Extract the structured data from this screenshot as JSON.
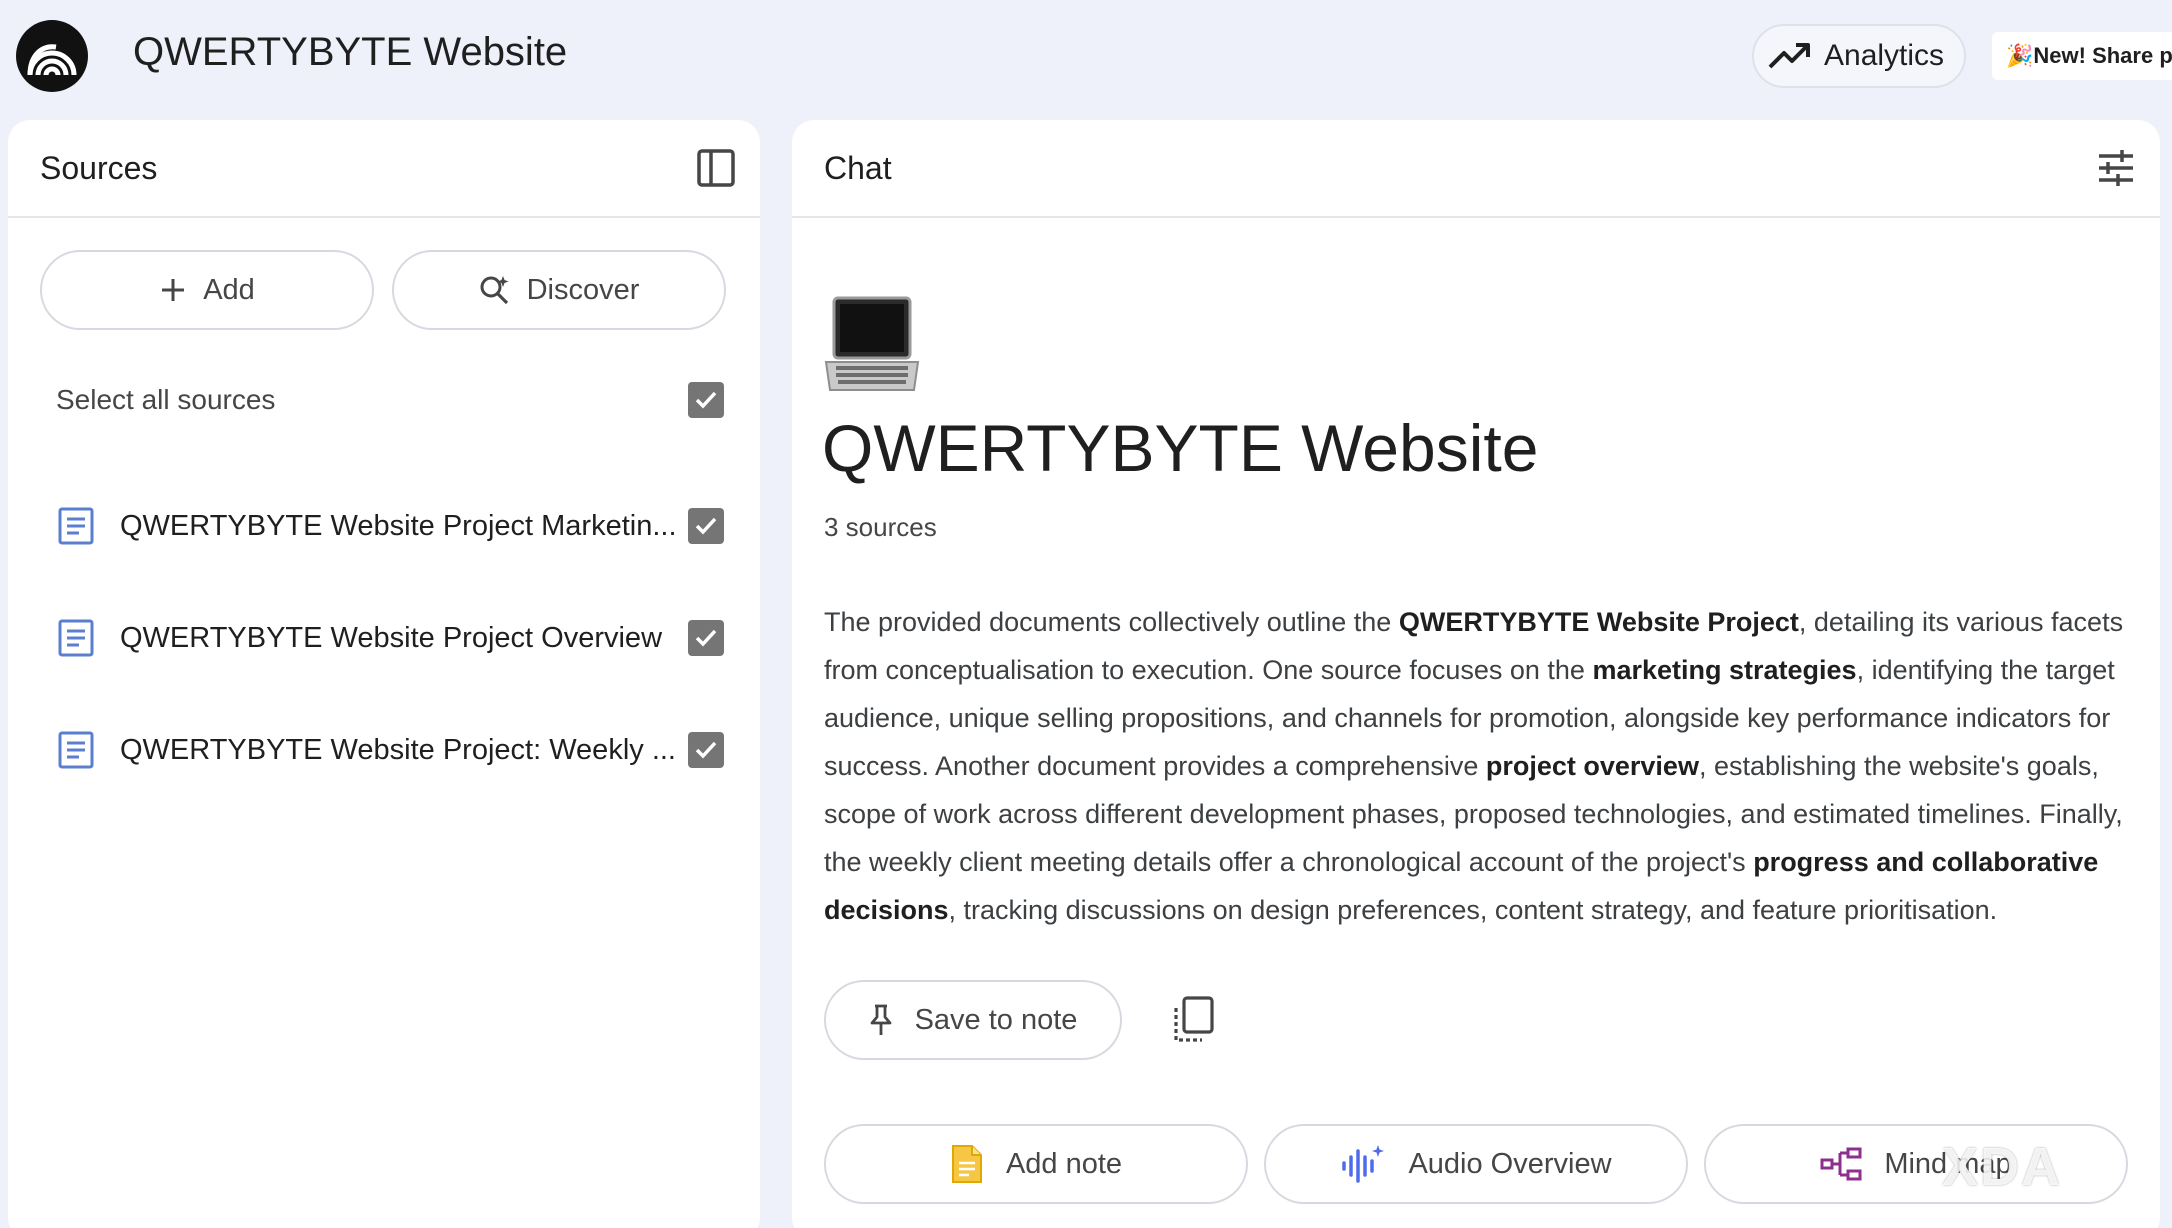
{
  "app": {
    "title": "QWERTYBYTE Website",
    "analytics_label": "Analytics",
    "new_share_label": "🎉New! Share p"
  },
  "sources_panel": {
    "title": "Sources",
    "add_label": "Add",
    "discover_label": "Discover",
    "select_all_label": "Select all sources",
    "items": [
      {
        "label": "QWERTYBYTE Website Project Marketin...",
        "checked": true
      },
      {
        "label": "QWERTYBYTE Website Project Overview",
        "checked": true
      },
      {
        "label": "QWERTYBYTE Website Project: Weekly ...",
        "checked": true
      }
    ]
  },
  "chat_panel": {
    "title": "Chat",
    "notebook_title": "QWERTYBYTE Website",
    "source_count": "3 sources",
    "summary": [
      {
        "text": "The provided documents collectively outline the ",
        "bold": false
      },
      {
        "text": "QWERTYBYTE Website Project",
        "bold": true
      },
      {
        "text": ", detailing its various facets from conceptualisation to execution. One source focuses on the ",
        "bold": false
      },
      {
        "text": "marketing strategies",
        "bold": true
      },
      {
        "text": ", identifying the target audience, unique selling propositions, and channels for promotion, alongside key performance indicators for success. Another document provides a comprehensive ",
        "bold": false
      },
      {
        "text": "project overview",
        "bold": true
      },
      {
        "text": ", establishing the website's goals, scope of work across different development phases, proposed technologies, and estimated timelines. Finally, the weekly client meeting details offer a chronological account of the project's ",
        "bold": false
      },
      {
        "text": "progress and collaborative decisions",
        "bold": true
      },
      {
        "text": ", tracking discussions on design preferences, content strategy, and feature prioritisation.",
        "bold": false
      }
    ],
    "save_to_note_label": "Save to note",
    "add_note_label": "Add note",
    "audio_overview_label": "Audio Overview",
    "mind_map_label": "Mind map"
  },
  "watermark": "XDA",
  "colors": {
    "background": "#eef1fa",
    "panel": "#ffffff",
    "checkbox": "#757575",
    "doc_icon": "#5b7ecf",
    "audio_icon": "#4f6bed",
    "note_icon": "#f2b705",
    "mind_map_icon": "#8e2f8f"
  },
  "icons": [
    "notebooklm-logo-icon",
    "trending-up-icon",
    "panel-toggle-icon",
    "plus-icon",
    "discover-icon",
    "checkbox-icon",
    "document-icon",
    "laptop-icon",
    "tune-icon",
    "pin-icon",
    "copy-icon",
    "note-icon",
    "audio-wave-icon",
    "mind-map-icon"
  ]
}
